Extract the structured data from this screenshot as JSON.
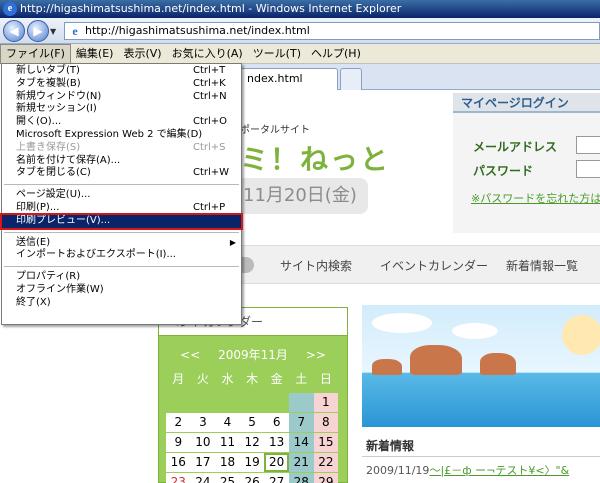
{
  "window": {
    "title": "http://higashimatsushima.net/index.html - Windows Internet Explorer"
  },
  "address": {
    "url": "http://higashimatsushima.net/index.html"
  },
  "menubar": [
    "ファイル(F)",
    "編集(E)",
    "表示(V)",
    "お気に入り(A)",
    "ツール(T)",
    "ヘルプ(H)"
  ],
  "tab": {
    "label": "ndex.html"
  },
  "file_menu": {
    "groups": [
      [
        {
          "label": "新しいタブ(T)",
          "shortcut": "Ctrl+T",
          "enabled": true
        },
        {
          "label": "タブを複製(B)",
          "shortcut": "Ctrl+K",
          "enabled": true
        },
        {
          "label": "新規ウィンドウ(N)",
          "shortcut": "Ctrl+N",
          "enabled": true
        },
        {
          "label": "新規セッション(I)",
          "shortcut": "",
          "enabled": true
        },
        {
          "label": "開く(O)...",
          "shortcut": "Ctrl+O",
          "enabled": true
        },
        {
          "label": "Microsoft Expression Web 2 で編集(D)",
          "shortcut": "",
          "enabled": true
        },
        {
          "label": "上書き保存(S)",
          "shortcut": "Ctrl+S",
          "enabled": false
        },
        {
          "label": "名前を付けて保存(A)...",
          "shortcut": "",
          "enabled": true
        },
        {
          "label": "タブを閉じる(C)",
          "shortcut": "Ctrl+W",
          "enabled": true
        }
      ],
      [
        {
          "label": "ページ設定(U)...",
          "shortcut": "",
          "enabled": true
        },
        {
          "label": "印刷(P)...",
          "shortcut": "Ctrl+P",
          "enabled": true
        },
        {
          "label": "印刷プレビュー(V)...",
          "shortcut": "",
          "enabled": true,
          "highlighted": true
        }
      ],
      [
        {
          "label": "送信(E)",
          "shortcut": "",
          "enabled": true,
          "submenu": true
        },
        {
          "label": "インポートおよびエクスポート(I)...",
          "shortcut": "",
          "enabled": true
        }
      ],
      [
        {
          "label": "プロパティ(R)",
          "shortcut": "",
          "enabled": true
        },
        {
          "label": "オフライン作業(W)",
          "shortcut": "",
          "enabled": true
        },
        {
          "label": "終了(X)",
          "shortcut": "",
          "enabled": true
        }
      ]
    ]
  },
  "site": {
    "subtitle": "ポータルサイト",
    "title": "ミ！ねっと",
    "date": "11月20日(金)",
    "login": {
      "heading": "マイページログイン",
      "email_label": "メールアドレス",
      "password_label": "パスワード",
      "forgot_link": "※パスワードを忘れた方はこ"
    },
    "nav": [
      "サイト内検索",
      "イベントカレンダー",
      "新着情報一覧"
    ],
    "calendar": {
      "heading": "ベントカレンダー",
      "prev": "<<",
      "month": "2009年11月",
      "next": ">>",
      "weekdays": [
        "月",
        "火",
        "水",
        "木",
        "金",
        "土",
        "日"
      ],
      "weeks": [
        [
          "",
          "",
          "",
          "",
          "",
          "",
          "1"
        ],
        [
          "2",
          "3",
          "4",
          "5",
          "6",
          "7",
          "8"
        ],
        [
          "9",
          "10",
          "11",
          "12",
          "13",
          "14",
          "15"
        ],
        [
          "16",
          "17",
          "18",
          "19",
          "20",
          "21",
          "22"
        ],
        [
          "23",
          "24",
          "25",
          "26",
          "27",
          "28",
          "29"
        ]
      ],
      "today": "20",
      "holiday": "23"
    },
    "news": {
      "heading": "新着情報",
      "items": [
        {
          "date": "2009/11/19",
          "title": "～|£－ф ー¬テスト¥<〉\"&"
        }
      ]
    },
    "colors": {
      "accent_green": "#7fb23d",
      "menu_highlight": "#0a246a",
      "highlight_box": "#d21818"
    }
  }
}
